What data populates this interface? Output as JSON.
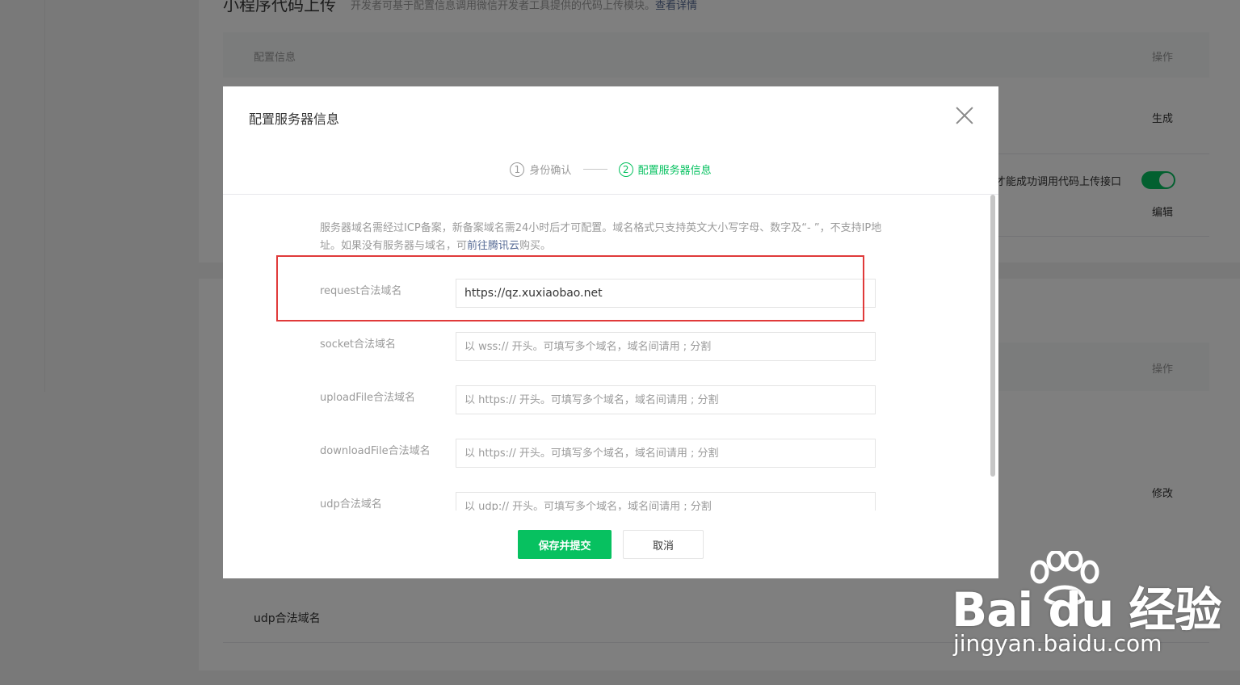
{
  "background": {
    "section_title": "小程序代码上传",
    "section_desc": "开发者可基于配置信息调用微信开发者工具提供的代码上传模块。",
    "section_link": "查看详情",
    "table_col_config": "配置信息",
    "table_col_op": "操作",
    "op_generate": "生成",
    "toggle_text": "才能成功调用代码上传接口",
    "op_edit": "编辑",
    "table2_col_op": "操作",
    "op_modify": "修改",
    "udp_label": "udp合法域名"
  },
  "dialog": {
    "title": "配置服务器信息",
    "steps": [
      {
        "num": "1",
        "label": "身份确认"
      },
      {
        "num": "2",
        "label": "配置服务器信息"
      }
    ],
    "notice_text": "服务器域名需经过ICP备案，新备案域名需24小时后才可配置。域名格式只支持英文大小写字母、数字及“- ”，不支持IP地址。如果没有服务器与域名，可",
    "notice_link": "前往腾讯云",
    "notice_end": "购买。",
    "fields": [
      {
        "label": "request合法域名",
        "value": "https://qz.xuxiaobao.net",
        "placeholder": ""
      },
      {
        "label": "socket合法域名",
        "value": "",
        "placeholder": "以 wss:// 开头。可填写多个域名，域名间请用 ; 分割"
      },
      {
        "label": "uploadFile合法域名",
        "value": "",
        "placeholder": "以 https:// 开头。可填写多个域名，域名间请用 ; 分割"
      },
      {
        "label": "downloadFile合法域名",
        "value": "",
        "placeholder": "以 https:// 开头。可填写多个域名，域名间请用 ; 分割"
      },
      {
        "label": "udp合法域名",
        "value": "",
        "placeholder": "以 udp:// 开头。可填写多个域名，域名间请用 ; 分割"
      }
    ],
    "submit_label": "保存并提交",
    "cancel_label": "取消"
  },
  "watermark": {
    "logo_text": "Bai du 经验",
    "url": "jingyan.baidu.com"
  },
  "colors": {
    "accent": "#07c160",
    "highlight": "#e03a3a",
    "link": "#576b95"
  }
}
